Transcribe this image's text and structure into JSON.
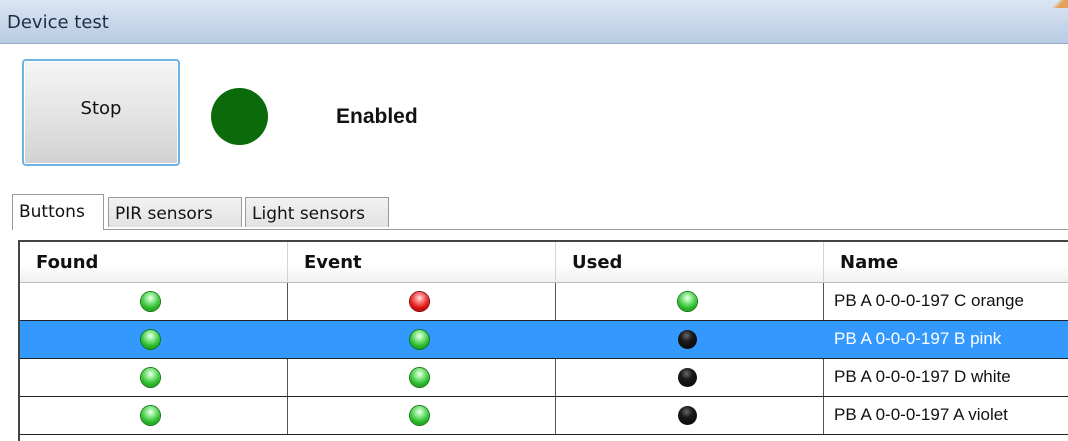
{
  "window": {
    "title": "Device test"
  },
  "controls": {
    "stop_label": "Stop",
    "status_text": "Enabled",
    "status_led_color": "#0b6b0b"
  },
  "tabs": [
    {
      "label": "Buttons",
      "active": true
    },
    {
      "label": "PIR sensors",
      "active": false
    },
    {
      "label": "Light sensors",
      "active": false
    }
  ],
  "table": {
    "columns": [
      "Found",
      "Event",
      "Used",
      "Name"
    ],
    "rows": [
      {
        "found": "green",
        "event": "red",
        "used": "green",
        "name": "PB A 0-0-0-197 C orange",
        "selected": false
      },
      {
        "found": "green",
        "event": "green",
        "used": "black",
        "name": "PB A 0-0-0-197 B pink",
        "selected": true
      },
      {
        "found": "green",
        "event": "green",
        "used": "black",
        "name": "PB A 0-0-0-197 D white",
        "selected": false
      },
      {
        "found": "green",
        "event": "green",
        "used": "black",
        "name": "PB A 0-0-0-197 A violet",
        "selected": false
      }
    ]
  },
  "colors": {
    "selection": "#3399ff",
    "led_green": "#2fbf2f",
    "led_red": "#e01515",
    "led_off": "#000000"
  }
}
